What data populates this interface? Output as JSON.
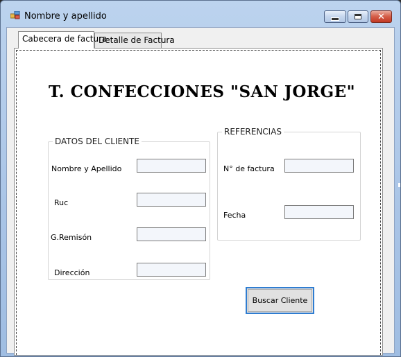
{
  "window": {
    "title": "Nombre y apellido",
    "icons": [
      "app-icon",
      "minimize-icon",
      "maximize-icon",
      "close-icon"
    ],
    "close_glyph": "✕"
  },
  "tabs": [
    {
      "label": "Cabecera de factura",
      "active": true
    },
    {
      "label": "Detalle de Factura",
      "active": false
    }
  ],
  "header": {
    "company": "T. CONFECCIONES \"SAN JORGE\""
  },
  "cliente": {
    "legend": "DATOS DEL CLIENTE",
    "fields": [
      {
        "label": "Nombre y Apellido",
        "value": ""
      },
      {
        "label": "Ruc",
        "value": ""
      },
      {
        "label": "G.Remisón",
        "value": ""
      },
      {
        "label": "Dirección",
        "value": ""
      }
    ]
  },
  "referencias": {
    "legend": "REFERENCIAS",
    "fields": [
      {
        "label": "N° de factura",
        "value": ""
      },
      {
        "label": "Fecha",
        "value": ""
      }
    ]
  },
  "actions": {
    "buscar_label": "Buscar Cliente"
  },
  "colors": {
    "button_focus": "#2f7dd1",
    "textbox_bg": "#f3f6fb",
    "title_bar": "#bcd3ee"
  }
}
